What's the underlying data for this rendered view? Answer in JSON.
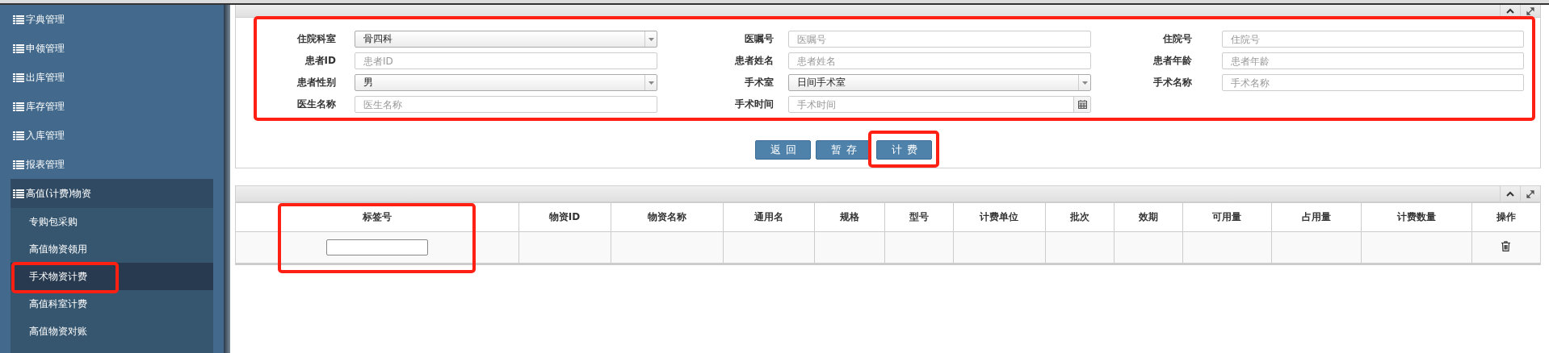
{
  "sidebar": {
    "items": [
      {
        "label": "字典管理"
      },
      {
        "label": "申领管理"
      },
      {
        "label": "出库管理"
      },
      {
        "label": "库存管理"
      },
      {
        "label": "入库管理"
      },
      {
        "label": "报表管理"
      },
      {
        "label": "高值(计费)物资",
        "expanded": true,
        "children": [
          {
            "label": "专购包采购",
            "selected": false,
            "highlighted": false
          },
          {
            "label": "高值物资领用",
            "selected": false,
            "highlighted": false
          },
          {
            "label": "手术物资计费",
            "selected": true,
            "highlighted": true
          },
          {
            "label": "高值科室计费",
            "selected": false,
            "highlighted": false
          },
          {
            "label": "高值物资对账",
            "selected": false,
            "highlighted": false
          }
        ]
      }
    ]
  },
  "form": {
    "highlighted": true,
    "fields": [
      {
        "label": "住院科室",
        "kind": "select",
        "value": "骨四科"
      },
      {
        "label": "医嘱号",
        "kind": "text",
        "placeholder": "医嘱号"
      },
      {
        "label": "住院号",
        "kind": "text",
        "placeholder": "住院号"
      },
      {
        "label": "患者ID",
        "kind": "text",
        "placeholder": "患者ID"
      },
      {
        "label": "患者姓名",
        "kind": "text",
        "placeholder": "患者姓名"
      },
      {
        "label": "患者年龄",
        "kind": "text",
        "placeholder": "患者年龄"
      },
      {
        "label": "患者性别",
        "kind": "select",
        "value": "男"
      },
      {
        "label": "手术室",
        "kind": "select",
        "value": "日间手术室"
      },
      {
        "label": "手术名称",
        "kind": "text",
        "placeholder": "手术名称"
      },
      {
        "label": "医生名称",
        "kind": "text",
        "placeholder": "医生名称"
      },
      {
        "label": "手术时间",
        "kind": "date",
        "placeholder": "手术时间"
      }
    ]
  },
  "buttons": [
    {
      "label": "返回",
      "highlighted": false
    },
    {
      "label": "暂存",
      "highlighted": false
    },
    {
      "label": "计费",
      "highlighted": true
    }
  ],
  "table": {
    "columns": [
      {
        "label": "标签号",
        "highlighted": true
      },
      {
        "label": "物资ID",
        "highlighted": false
      },
      {
        "label": "物资名称",
        "highlighted": false
      },
      {
        "label": "通用名",
        "highlighted": false
      },
      {
        "label": "规格",
        "highlighted": false
      },
      {
        "label": "型号",
        "highlighted": false
      },
      {
        "label": "计费单位",
        "highlighted": false
      },
      {
        "label": "批次",
        "highlighted": false
      },
      {
        "label": "效期",
        "highlighted": false
      },
      {
        "label": "可用量",
        "highlighted": false
      },
      {
        "label": "占用量",
        "highlighted": false
      },
      {
        "label": "计费数量",
        "highlighted": false
      },
      {
        "label": "操作",
        "highlighted": false
      }
    ],
    "rows": [
      {
        "kind": "entry"
      }
    ]
  }
}
